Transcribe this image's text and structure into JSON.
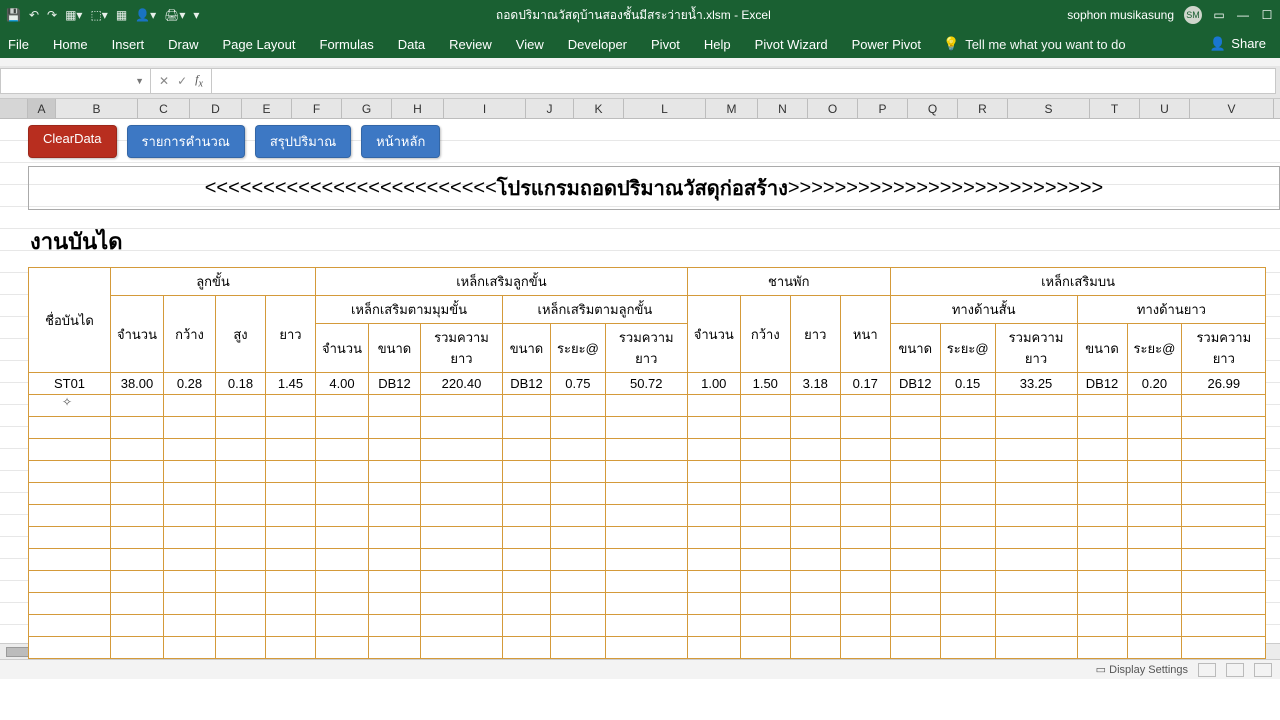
{
  "titlebar": {
    "doc_title": "ถอดปริมาณวัสดุบ้านสองชั้นมีสระว่ายน้ำ.xlsm - Excel",
    "user_name": "sophon musikasung",
    "user_initials": "SM"
  },
  "ribbon": {
    "tabs": [
      "File",
      "Home",
      "Insert",
      "Draw",
      "Page Layout",
      "Formulas",
      "Data",
      "Review",
      "View",
      "Developer",
      "Pivot",
      "Help",
      "Pivot Wizard",
      "Power Pivot"
    ],
    "tellme": "Tell me what you want to do",
    "share": "Share"
  },
  "formula_bar": {
    "namebox": "",
    "formula": ""
  },
  "columns": [
    "A",
    "B",
    "C",
    "D",
    "E",
    "F",
    "G",
    "H",
    "I",
    "J",
    "K",
    "L",
    "M",
    "N",
    "O",
    "P",
    "Q",
    "R",
    "S",
    "T",
    "U",
    "V"
  ],
  "buttons": {
    "clear": "ClearData",
    "calc_list": "รายการคำนวณ",
    "summary": "สรุปปริมาณ",
    "main": "หน้าหลัก"
  },
  "banner": {
    "left_arrows": "<<<<<<<<<<<<<<<<<<<<<<<<<",
    "text": "โปรแกรมถอดปริมาณวัสดุก่อสร้าง",
    "right_arrows": ">>>>>>>>>>>>>>>>>>>>>>>>>>>"
  },
  "section_title": "งานบันได",
  "headers": {
    "stair_name": "ชื่อบันได",
    "step_group": "ลูกขั้น",
    "rebar_step_group": "เหล็กเสริมลูกขั้น",
    "rebar_corner": "เหล็กเสริมตามมุมขั้น",
    "rebar_along": "เหล็กเสริมตามลูกขั้น",
    "landing_group": "ชานพัก",
    "rebar_top": "เหล็กเสริมบน",
    "short_side": "ทางด้านสั้น",
    "long_side": "ทางด้านยาว",
    "qty": "จำนวน",
    "width": "กว้าง",
    "height": "สูง",
    "length": "ยาว",
    "size": "ขนาด",
    "spacing": "ระยะ@",
    "total_len": "รวมความยาว",
    "thick": "หนา"
  },
  "row": {
    "name": "ST01",
    "step_qty": "38.00",
    "step_w": "0.28",
    "step_h": "0.18",
    "step_l": "1.45",
    "corner_qty": "4.00",
    "corner_size": "DB12",
    "corner_total": "220.40",
    "along_size": "DB12",
    "along_spc": "0.75",
    "along_total": "50.72",
    "land_qty": "1.00",
    "land_w": "1.50",
    "land_l": "3.18",
    "land_t": "0.17",
    "short_size": "DB12",
    "short_spc": "0.15",
    "short_total": "33.25",
    "long_size": "DB12",
    "long_spc": "0.20",
    "long_total": "26.99"
  },
  "statusbar": {
    "display_settings": "Display Settings"
  },
  "chart_data": {
    "type": "table",
    "title": "งานบันได",
    "columns": [
      "ชื่อบันได",
      "ลูกขั้น จำนวน",
      "ลูกขั้น กว้าง",
      "ลูกขั้น สูง",
      "ลูกขั้น ยาว",
      "มุมขั้น จำนวน",
      "มุมขั้น ขนาด",
      "มุมขั้น รวมความยาว",
      "ตามลูกขั้น ขนาด",
      "ตามลูกขั้น ระยะ@",
      "ตามลูกขั้น รวมความยาว",
      "ชานพัก จำนวน",
      "ชานพัก กว้าง",
      "ชานพัก ยาว",
      "ชานพัก หนา",
      "บน-สั้น ขนาด",
      "บน-สั้น ระยะ@",
      "บน-สั้น รวมความยาว",
      "บน-ยาว ขนาด",
      "บน-ยาว ระยะ@",
      "บน-ยาว รวมความยาว"
    ],
    "rows": [
      [
        "ST01",
        38.0,
        0.28,
        0.18,
        1.45,
        4.0,
        "DB12",
        220.4,
        "DB12",
        0.75,
        50.72,
        1.0,
        1.5,
        3.18,
        0.17,
        "DB12",
        0.15,
        33.25,
        "DB12",
        0.2,
        26.99
      ]
    ]
  }
}
